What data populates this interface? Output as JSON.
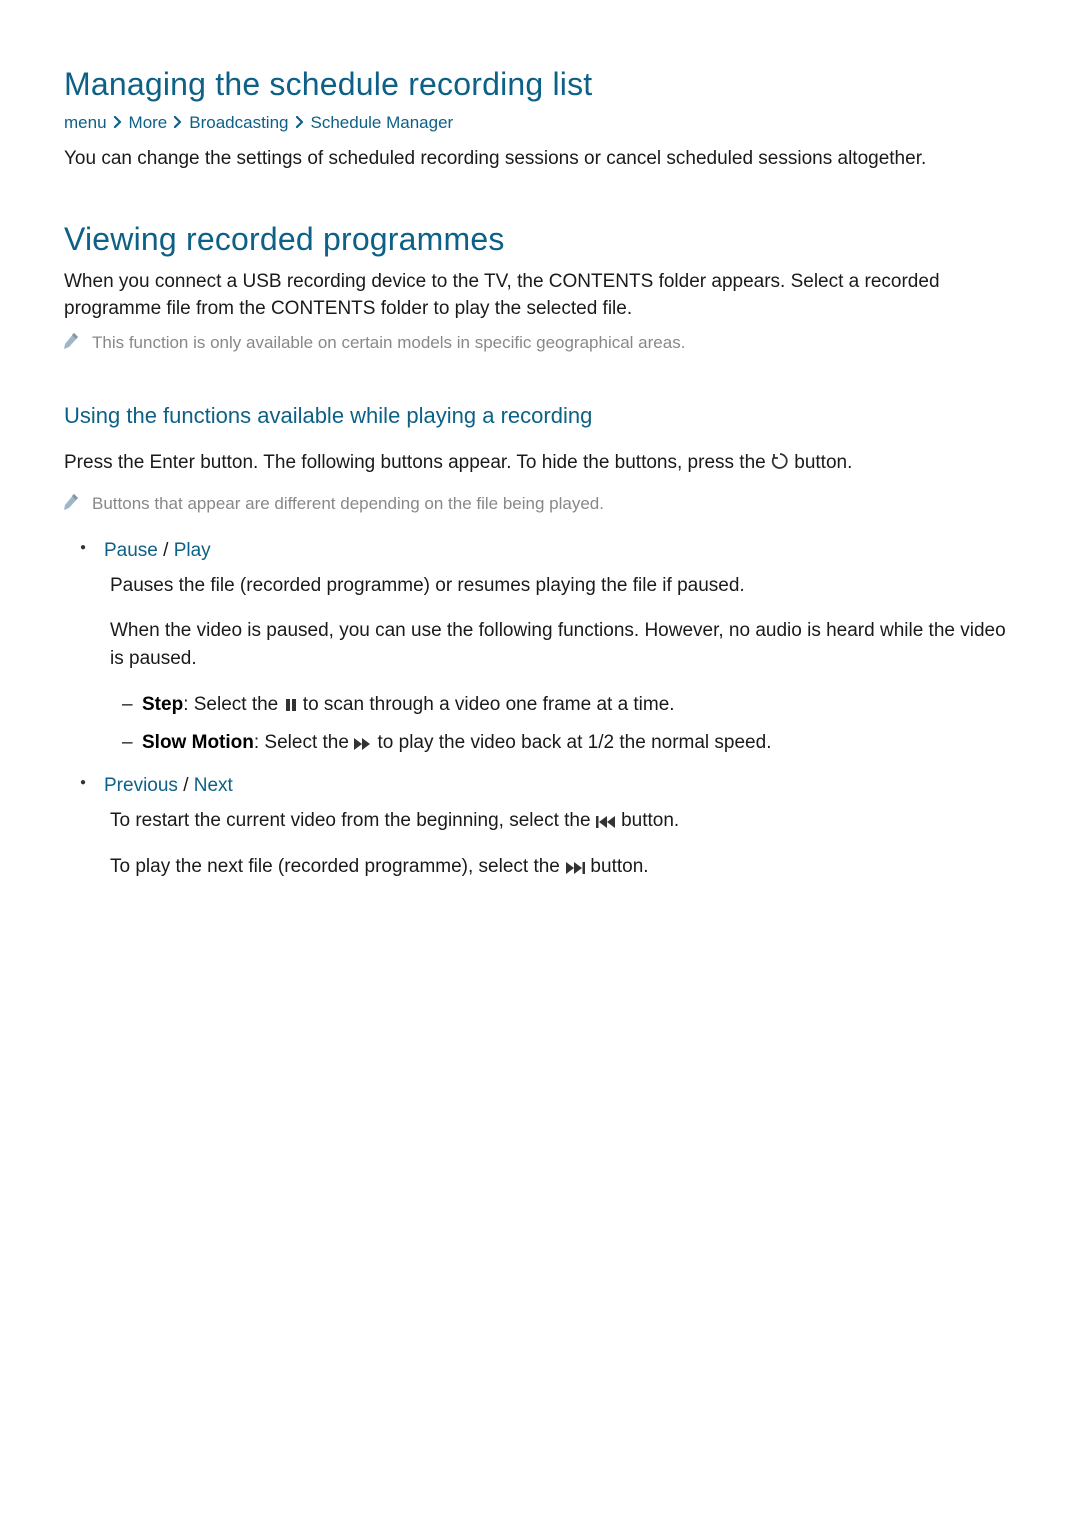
{
  "section1": {
    "title": "Managing the schedule recording list",
    "breadcrumb": {
      "menu": "menu",
      "more": "More",
      "broadcasting": "Broadcasting",
      "schedule_manager": "Schedule Manager"
    },
    "body": "You can change the settings of scheduled recording sessions or cancel scheduled sessions altogether."
  },
  "section2": {
    "title": "Viewing recorded programmes",
    "body": "When you connect a USB recording device to the TV, the CONTENTS folder appears. Select a recorded programme file from the CONTENTS folder to play the selected file.",
    "note": "This function is only available on certain models in specific geographical areas."
  },
  "section3": {
    "title": "Using the functions available while playing a recording",
    "intro_pre": "Press the Enter button. The following buttons appear. To hide the buttons, press the ",
    "intro_post": " button.",
    "note": "Buttons that appear are different depending on the file being played.",
    "bullets": [
      {
        "head_a": "Pause",
        "slash": " / ",
        "head_b": "Play",
        "p1": "Pauses the file (recorded programme) or resumes playing the file if paused.",
        "p2": "When the video is paused, you can use the following functions. However, no audio is heard while the video is paused.",
        "dashes": [
          {
            "strong": "Step",
            "pre": ": Select the ",
            "post": " to scan through a video one frame at a time."
          },
          {
            "strong": "Slow Motion",
            "pre": ": Select the ",
            "post": " to play the video back at 1/2 the normal speed."
          }
        ]
      },
      {
        "head_a": "Previous",
        "slash": " / ",
        "head_b": "Next",
        "p1_pre": "To restart the current video from the beginning, select the ",
        "p1_post": " button.",
        "p2_pre": "To play the next file (recorded programme), select the ",
        "p2_post": " button."
      }
    ]
  }
}
